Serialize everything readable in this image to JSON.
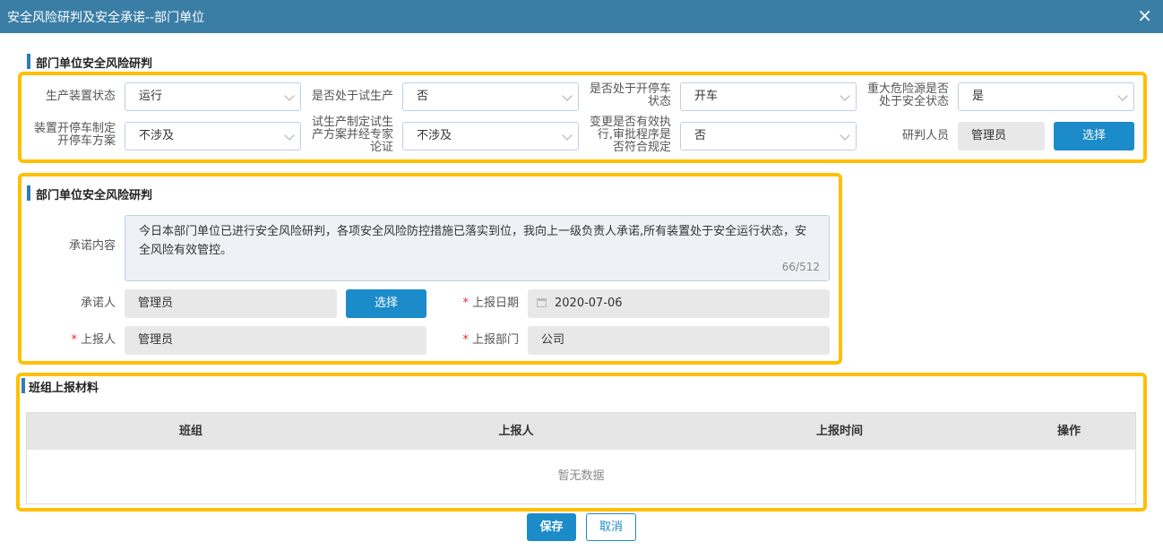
{
  "dialog": {
    "title": "安全风险研判及安全承诺--部门单位",
    "close_icon": "×"
  },
  "section1": {
    "title": "部门单位安全风险研判",
    "fields": [
      {
        "label": "生产装置状态",
        "value": "运行"
      },
      {
        "label": "是否处于试生产",
        "value": "否"
      },
      {
        "label_lines": [
          "是否处于开停车",
          "状态"
        ],
        "value": "开车"
      },
      {
        "label_lines": [
          "重大危险源是否",
          "处于安全状态"
        ],
        "value": "是"
      },
      {
        "label_lines": [
          "装置开停车制定",
          "开停车方案"
        ],
        "value": "不涉及"
      },
      {
        "label_lines": [
          "试生产制定试生",
          "产方案并经专家",
          "论证"
        ],
        "value": "不涉及"
      },
      {
        "label_lines": [
          "变更是否有效执",
          "行,审批程序是",
          "否符合规定"
        ],
        "value": "否"
      }
    ],
    "judge": {
      "label": "研判人员",
      "value": "管理员",
      "button": "选择"
    }
  },
  "section2": {
    "title": "部门单位安全风险研判",
    "content_label": "承诺内容",
    "content_lines": [
      "今日本部门单位已进行安全风险研判，各项安全风险防控措施已落实到位，我向上一级负责人承诺,所有装置处于安全运行状态，安",
      "全风险有效管控。"
    ],
    "counter": "66/512",
    "promiser": {
      "label": "承诺人",
      "value": "管理员",
      "button": "选择"
    },
    "report_date": {
      "label": "上报日期",
      "value": "2020-07-06"
    },
    "reporter": {
      "label": "上报人",
      "value": "管理员"
    },
    "report_dept": {
      "label": "上报部门",
      "value": "公司"
    },
    "required_mark": "*"
  },
  "section3": {
    "title": "班组上报材料",
    "columns": [
      "班组",
      "上报人",
      "上报时间",
      "操作"
    ],
    "empty_text": "暂无数据"
  },
  "footer": {
    "save": "保存",
    "cancel": "取消"
  },
  "colors": {
    "titlebar": "#3a7ea6",
    "primary": "#1c8bc9",
    "highlight": "#ffbf00"
  }
}
